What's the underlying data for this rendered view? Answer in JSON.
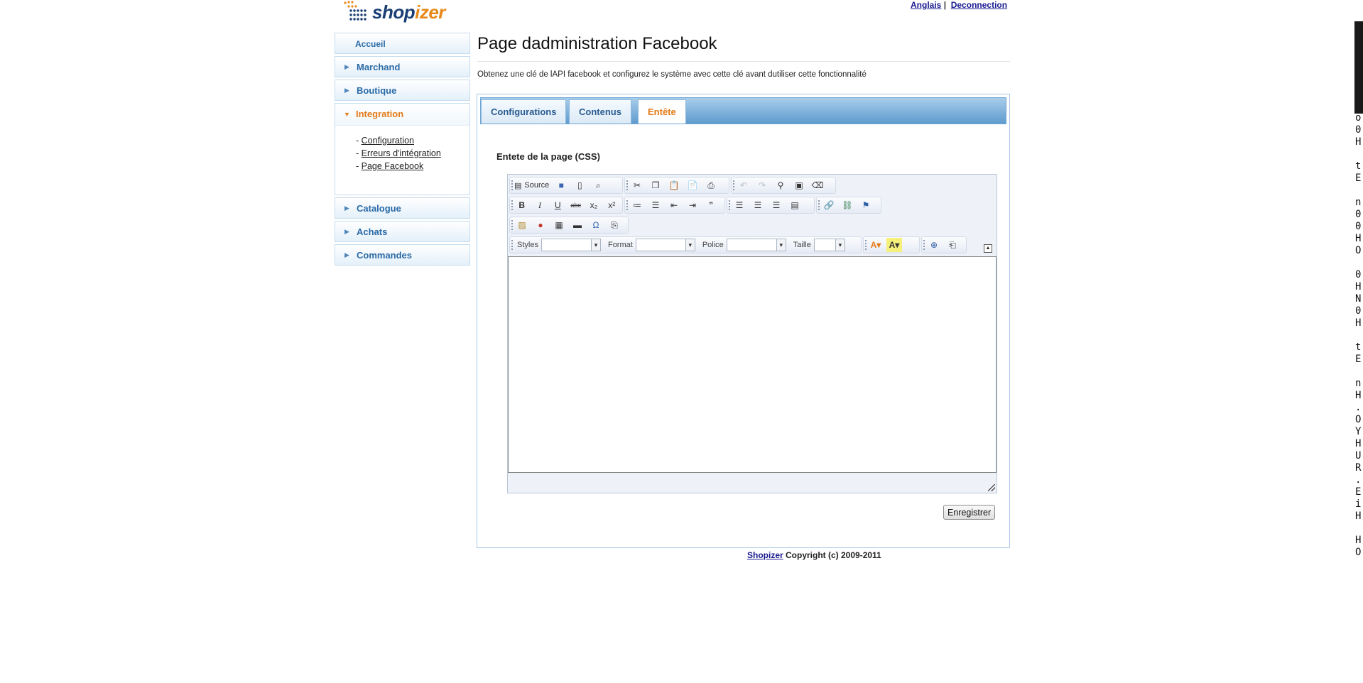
{
  "header": {
    "logo_text": "shopizer",
    "lang_link": "Anglais",
    "separator": "|",
    "logout_link": "Deconnection"
  },
  "sidebar": {
    "items": [
      {
        "label": "Accueil"
      },
      {
        "label": "Marchand"
      },
      {
        "label": "Boutique"
      },
      {
        "label": "Integration",
        "expanded": true,
        "subitems": [
          "Configuration",
          "Erreurs d'intégration",
          "Page Facebook"
        ]
      },
      {
        "label": "Catalogue"
      },
      {
        "label": "Achats"
      },
      {
        "label": "Commandes"
      }
    ]
  },
  "main": {
    "title": "Page dadministration Facebook",
    "description": "Obtenez une clé de lAPI facebook et configurez le système avec cette clé avant dutiliser cette fonctionnalité",
    "tabs": [
      {
        "label": "Configurations",
        "active": false
      },
      {
        "label": "Contenus",
        "active": false
      },
      {
        "label": "Entête",
        "active": true
      }
    ],
    "section_label": "Entete de la page (CSS)",
    "editor": {
      "source_label": "Source",
      "styles_label": "Styles",
      "format_label": "Format",
      "font_label": "Police",
      "size_label": "Taille",
      "content": ""
    },
    "save_button": "Enregistrer"
  },
  "footer": {
    "brand_link": "Shopizer",
    "copyright": "Copyright (c) 2009-2011"
  },
  "terminal_strip": "o\n0\nH\n\nt\nE\n\nn\n0\n0\nH\nO\n\n0\nH\nN\n0\nH\n\nt\nE\n\nn\nH\n.\nO\nY\nH\nU\nR\n.\nE\ni\nH\n\nH\nO",
  "colors": {
    "accent_orange": "#e37a17",
    "nav_blue": "#2a6aa6",
    "tab_bar": "#5f9bcf"
  }
}
